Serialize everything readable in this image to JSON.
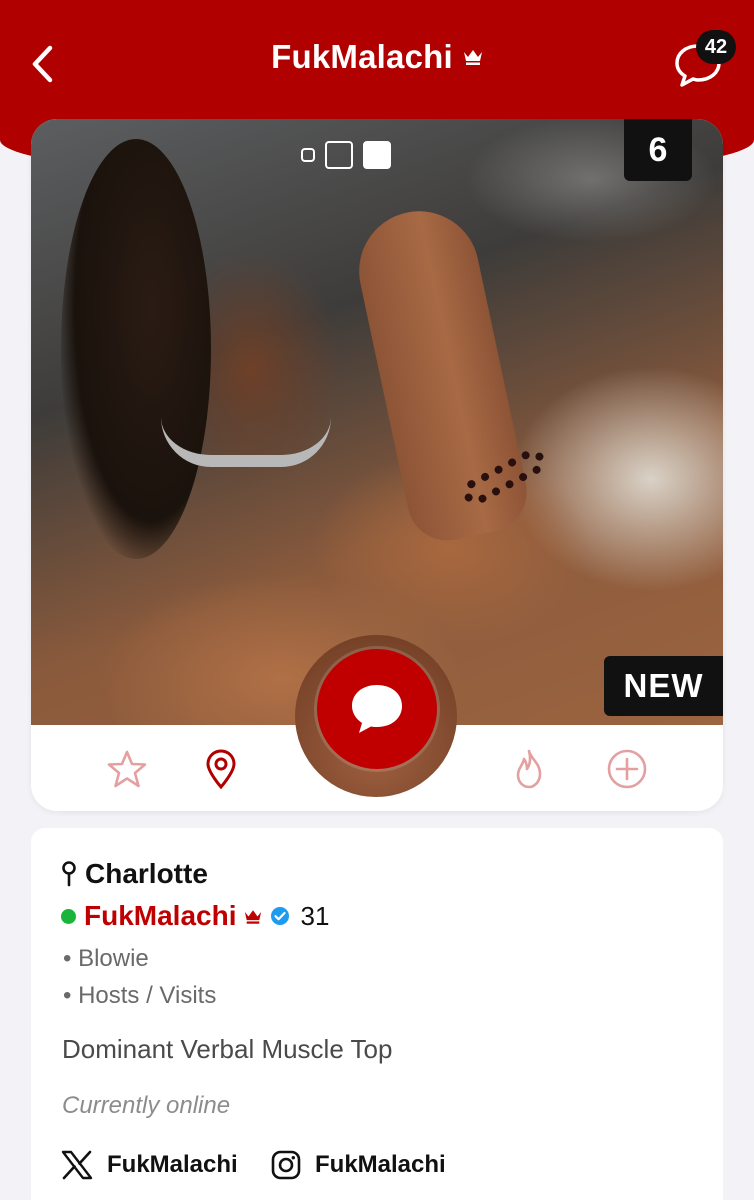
{
  "header": {
    "title": "FukMalachi",
    "chat_badge": "42",
    "colors": {
      "brand": "#b00000"
    }
  },
  "card": {
    "photo_count": "6",
    "new_label": "NEW",
    "gallery_pages": 3,
    "active_page": 3,
    "actions": [
      "star-icon",
      "location-pin-icon",
      "message-icon",
      "flame-icon",
      "plus-circle-icon"
    ]
  },
  "profile": {
    "location": "Charlotte",
    "name": "FukMalachi",
    "age": "31",
    "tags": [
      "• Blowie",
      "• Hosts / Visits"
    ],
    "bio": "Dominant Verbal Muscle Top",
    "status": "Currently online",
    "twitter": "FukMalachi",
    "instagram": "FukMalachi",
    "online_color": "#19b53b",
    "verified_color": "#1d9bf0"
  }
}
